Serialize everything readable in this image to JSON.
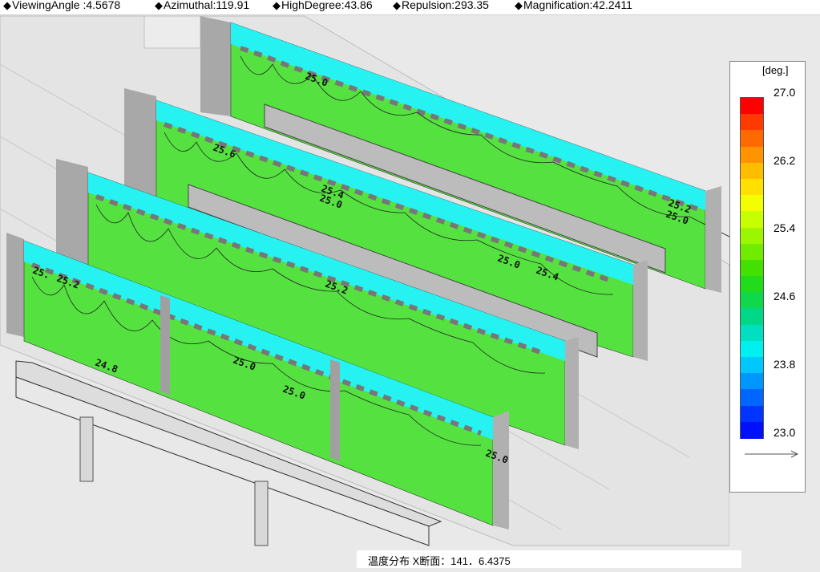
{
  "toolbar": {
    "params": [
      {
        "label": "ViewingAngle :4.5678"
      },
      {
        "label": "Azimuthal:119.91"
      },
      {
        "label": "HighDegree:43.86"
      },
      {
        "label": "Repulsion:293.35"
      },
      {
        "label": "Magnification:42.2411"
      }
    ]
  },
  "legend": {
    "unit": "[deg.]",
    "ticks": [
      "27.0",
      "26.2",
      "25.4",
      "24.6",
      "23.8",
      "23.0"
    ],
    "colors": [
      "#ff0000",
      "#ff3a00",
      "#ff6a00",
      "#ff9400",
      "#ffbd00",
      "#ffe000",
      "#f3ff00",
      "#c8ff00",
      "#9cf600",
      "#70ec00",
      "#44e000",
      "#22dc1c",
      "#10d84c",
      "#00d888",
      "#00e0c0",
      "#00f0f0",
      "#00c8ff",
      "#0096ff",
      "#0066ff",
      "#0034ff",
      "#0010ff"
    ]
  },
  "contour_labels": {
    "p1a": "25.0",
    "p1b": "25.2",
    "p1c": "25.0",
    "p2a": "25.6",
    "p2b": "25.4",
    "p2c": "25.0",
    "p3a": "25.0",
    "p3b": "25.4",
    "p4a": "25.",
    "p4b": "25.2",
    "p4c": "25.2",
    "p5a": "24.8",
    "p5b": "25.0",
    "p5c": "25.0",
    "p5d": "25.0"
  },
  "caption": {
    "text": "温度分布 X断面：141．6.4375"
  },
  "colors": {
    "panel_green": "#4fe03a",
    "panel_cyan": "#26f5f5",
    "wall_gray": "#a9a9a9",
    "floor": "#e6e6e6"
  }
}
